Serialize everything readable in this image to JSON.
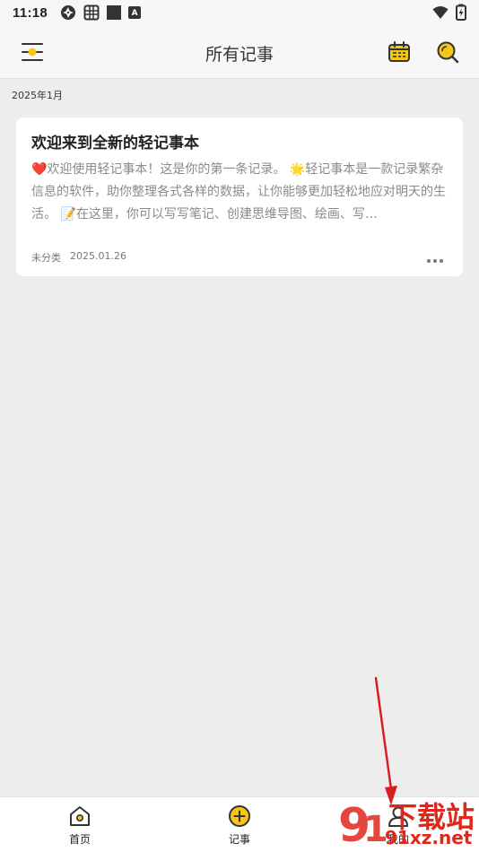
{
  "status_bar": {
    "time": "11:18",
    "left_icons": [
      "vpn-icon",
      "sim-icon",
      "square-icon",
      "a-icon"
    ],
    "right_icons": [
      "wifi-icon",
      "battery-charging-icon"
    ],
    "a_label": "A"
  },
  "app_bar": {
    "title": "所有记事",
    "menu_icon": "menu-sun-icon",
    "calendar_icon": "calendar-icon",
    "search_icon": "search-icon",
    "accent_color": "#f5c518"
  },
  "list": {
    "section_header": "2025年1月",
    "notes": [
      {
        "title": "欢迎来到全新的轻记事本",
        "preview": "❤️欢迎使用轻记事本！这是你的第一条记录。 🌟轻记事本是一款记录繁杂信息的软件，助你整理各式各样的数据，让你能够更加轻松地应对明天的生活。 📝在这里，你可以写写笔记、创建思维导图、绘画、写…",
        "category": "未分类",
        "date": "2025.01.26",
        "more_icon": "more-dots-icon"
      }
    ]
  },
  "bottom_nav": {
    "items": [
      {
        "label": "首页",
        "icon": "home-icon"
      },
      {
        "label": "记事",
        "icon": "add-circle-icon"
      },
      {
        "label": "我的",
        "icon": "user-icon"
      }
    ]
  },
  "watermark": {
    "top_text": "下载站",
    "bottom_text": "91xz.net",
    "color": "#e1261c"
  },
  "annotation": {
    "type": "red-arrow",
    "color": "#d62020",
    "points_to": "我的"
  }
}
